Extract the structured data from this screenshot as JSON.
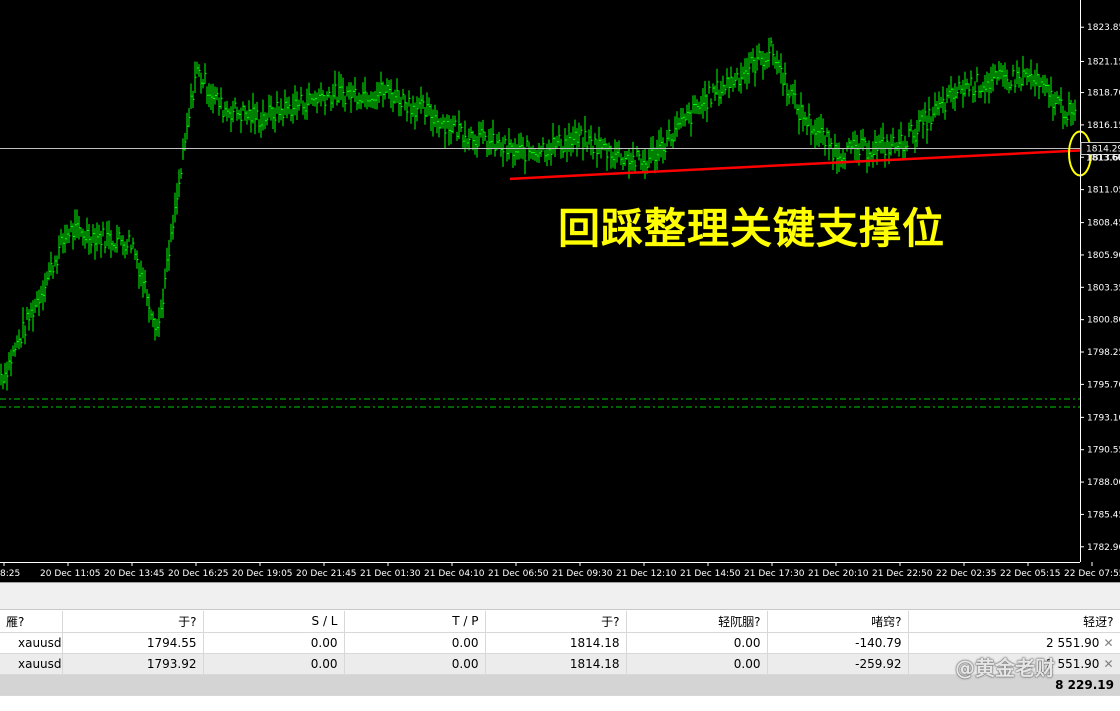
{
  "chart": {
    "background": "#000000",
    "bar_color": "#00ff00",
    "axis_color": "#ffffff",
    "current_price_line": "1814.29",
    "current_price_label": "1814.29",
    "bid_label": "1813.60",
    "stop_levels": [
      1794.55,
      1793.92
    ],
    "stop_level_color": "#00c800",
    "support_line_color": "#ff0000",
    "support_line_from": [
      "21 Dec 06:50",
      1811.9
    ],
    "support_line_to": [
      "22 Dec 07:55",
      1814.2
    ],
    "highlight_circle_color": "#ffff00",
    "annotation": "回踩整理关键支撑位"
  },
  "chart_data": {
    "type": "bar",
    "symbol": "xauusd",
    "ylim": [
      1781.7,
      1825.6
    ],
    "y_ticks": [
      "1823.85",
      "1821.15",
      "1818.70",
      "1816.15",
      "1813.60",
      "1811.05",
      "1808.45",
      "1805.90",
      "1803.35",
      "1800.80",
      "1798.25",
      "1795.70",
      "1793.10",
      "1790.55",
      "1788.00",
      "1785.45",
      "1782.90"
    ],
    "x_ticks": [
      "8:25",
      "20 Dec 11:05",
      "20 Dec 13:45",
      "20 Dec 16:25",
      "20 Dec 19:05",
      "20 Dec 21:45",
      "21 Dec 01:30",
      "21 Dec 04:10",
      "21 Dec 06:50",
      "21 Dec 09:30",
      "21 Dec 12:10",
      "21 Dec 14:50",
      "21 Dec 17:30",
      "21 Dec 20:10",
      "21 Dec 22:50",
      "22 Dec 02:35",
      "22 Dec 05:15",
      "22 Dec 07:55"
    ],
    "price_path": [
      [
        "8:25",
        1796.5
      ],
      [
        "20 Dec 11:05",
        1807.8
      ],
      [
        "20 Dec 13:45",
        1806.9
      ],
      [
        "20 Dec 13:45",
        1800.0
      ],
      [
        "20 Dec 16:25",
        1820.5
      ],
      [
        "20 Dec 16:25",
        1817.5
      ],
      [
        "20 Dec 19:05",
        1816.7
      ],
      [
        "20 Dec 21:45",
        1818.5
      ],
      [
        "21 Dec 01:30",
        1818.8
      ],
      [
        "21 Dec 04:10",
        1816.0
      ],
      [
        "21 Dec 06:50",
        1813.9
      ],
      [
        "21 Dec 09:30",
        1815.0
      ],
      [
        "21 Dec 12:10",
        1813.1
      ],
      [
        "21 Dec 14:50",
        1818.3
      ],
      [
        "21 Dec 17:30",
        1822.0
      ],
      [
        "21 Dec 17:30",
        1817.3
      ],
      [
        "21 Dec 20:10",
        1814.0
      ],
      [
        "21 Dec 22:50",
        1814.6
      ],
      [
        "22 Dec 02:35",
        1819.2
      ],
      [
        "22 Dec 05:15",
        1820.0
      ],
      [
        "22 Dec 07:55",
        1815.4
      ]
    ]
  },
  "table": {
    "headers": [
      "雁?",
      "于?",
      "S / L",
      "T / P",
      "于?",
      "轻阢胭?",
      "啫窍?",
      "轻迓?"
    ],
    "rows": [
      [
        "xauusd",
        "1794.55",
        "0.00",
        "0.00",
        "1814.18",
        "0.00",
        "-140.79",
        "2 551.90"
      ],
      [
        "xauusd",
        "1793.92",
        "0.00",
        "0.00",
        "1814.18",
        "0.00",
        "-259.92",
        "2 551.90"
      ]
    ],
    "close_icon": "close-icon",
    "summary_total": "8 229.19"
  },
  "watermark": "@黄金老财"
}
